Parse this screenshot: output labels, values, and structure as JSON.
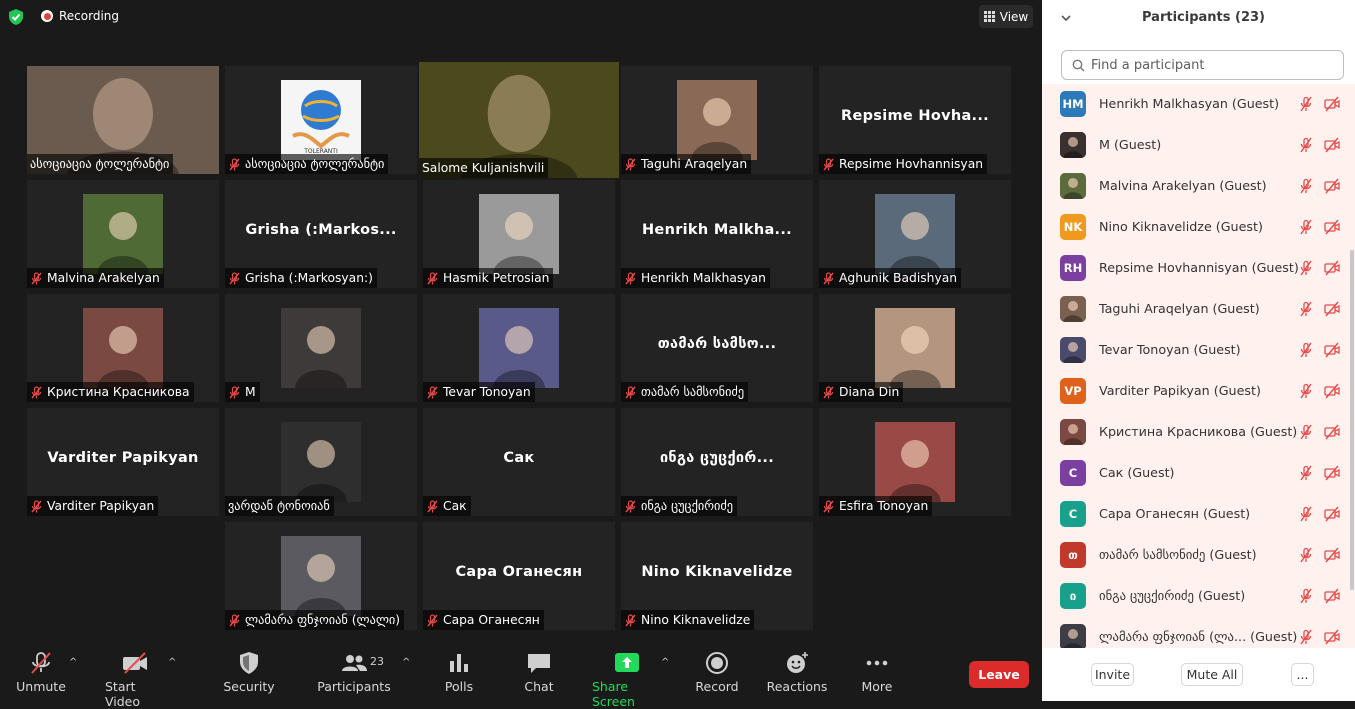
{
  "topbar": {
    "recording_label": "Recording",
    "view_label": "View"
  },
  "tiles": [
    {
      "name": "ასოციაცია ტოლერანტი",
      "kind": "video",
      "muted": false,
      "bg": "#6b5a4e"
    },
    {
      "name": "ასოციაცია ტოლერანტი",
      "kind": "thumb",
      "muted": true,
      "bg": "#f3f3f3",
      "logo_text": "TOLERANTI"
    },
    {
      "name": "Salome Kuljanishvili",
      "kind": "video",
      "muted": false,
      "active": true,
      "bg": "#4c4a1c"
    },
    {
      "name": "Taguhi Araqelyan",
      "kind": "thumb",
      "muted": true,
      "bg": "#8a6a56"
    },
    {
      "name": "Repsime Hovhannisyan",
      "kind": "text",
      "muted": true,
      "big": "Repsime  Hovha..."
    },
    {
      "name": "Malvina Arakelyan",
      "kind": "thumb",
      "muted": true,
      "bg": "#4f6a35"
    },
    {
      "name": "Grisha (:Markosyan:)",
      "kind": "text",
      "muted": true,
      "big": "Grisha  (:Markos..."
    },
    {
      "name": "Hasmik Petrosian",
      "kind": "thumb",
      "muted": true,
      "bg": "#9a9a9a"
    },
    {
      "name": "Henrikh Malkhasyan",
      "kind": "text",
      "muted": true,
      "big": "Henrikh  Malkha..."
    },
    {
      "name": "Aghunik Badishyan",
      "kind": "thumb",
      "muted": true,
      "bg": "#5a6a7a"
    },
    {
      "name": "Кристина Красникова",
      "kind": "thumb",
      "muted": true,
      "bg": "#7a4a42"
    },
    {
      "name": "M",
      "kind": "thumb",
      "muted": true,
      "bg": "#3f3a3a"
    },
    {
      "name": "Tevar Tonoyan",
      "kind": "thumb",
      "muted": true,
      "bg": "#5a5a8a"
    },
    {
      "name": "თამარ სამსონიძე",
      "kind": "text",
      "muted": true,
      "big": "თამარ  სამსო..."
    },
    {
      "name": "Diana Din",
      "kind": "thumb",
      "muted": true,
      "bg": "#b39580"
    },
    {
      "name": "Varditer Papikyan",
      "kind": "text",
      "muted": true,
      "big": "Varditer Papikyan"
    },
    {
      "name": "ვარდან ტონოიან",
      "kind": "thumb",
      "muted": false,
      "bg": "#2e2e2e"
    },
    {
      "name": "Сак",
      "kind": "text",
      "muted": true,
      "big": "Сак"
    },
    {
      "name": "ინგა ცუცქირიძე",
      "kind": "text",
      "muted": true,
      "big": "ინგა  ცუცქირ..."
    },
    {
      "name": "Esfira Tonoyan",
      "kind": "thumb",
      "muted": true,
      "bg": "#9a4a46"
    },
    {
      "name": "ლამარა ფნჯოიან (ლალი)",
      "kind": "thumb",
      "muted": true,
      "bg": "#5a5a60"
    },
    {
      "name": "Сара Оганесян",
      "kind": "text",
      "muted": true,
      "big": "Сара Оганесян"
    },
    {
      "name": "Nino Kiknavelidze",
      "kind": "text",
      "muted": true,
      "big": "Nino Kiknavelidze"
    }
  ],
  "toolbar": {
    "unmute": "Unmute",
    "start_video": "Start Video",
    "security": "Security",
    "participants": "Participants",
    "participants_count": "23",
    "polls": "Polls",
    "chat": "Chat",
    "share_screen": "Share Screen",
    "record": "Record",
    "reactions": "Reactions",
    "more": "More",
    "leave": "Leave"
  },
  "panel": {
    "title": "Participants (23)",
    "search_placeholder": "Find a participant",
    "invite": "Invite",
    "mute_all": "Mute All",
    "more": "...",
    "participants": [
      {
        "name": "Henrikh Malkhasyan (Guest)",
        "initials": "HM",
        "color": "#2d7ab8"
      },
      {
        "name": "M (Guest)",
        "initials": "",
        "color": "#3a3030"
      },
      {
        "name": "Malvina Arakelyan (Guest)",
        "initials": "",
        "color": "#5b6b3c"
      },
      {
        "name": "Nino Kiknavelidze (Guest)",
        "initials": "NK",
        "color": "#ef9a1e"
      },
      {
        "name": "Repsime Hovhannisyan (Guest)",
        "initials": "RH",
        "color": "#7b3fa0"
      },
      {
        "name": "Taguhi Araqelyan (Guest)",
        "initials": "",
        "color": "#7a6050"
      },
      {
        "name": "Tevar Tonoyan (Guest)",
        "initials": "",
        "color": "#4a4a6a"
      },
      {
        "name": "Varditer Papikyan (Guest)",
        "initials": "VP",
        "color": "#e0621a"
      },
      {
        "name": "Кристина Красникова (Guest)",
        "initials": "",
        "color": "#7a4a42"
      },
      {
        "name": "Сак (Guest)",
        "initials": "C",
        "color": "#7b3fa0"
      },
      {
        "name": "Сара Оганесян (Guest)",
        "initials": "C",
        "color": "#17a08a"
      },
      {
        "name": "თამარ სამსონიძე (Guest)",
        "initials": "თ",
        "color": "#c0392b"
      },
      {
        "name": "ინგა ცუცქირიძე (Guest)",
        "initials": "ი",
        "color": "#17a08a"
      },
      {
        "name": "ლამარა ფნჯოიან (ლა... (Guest)",
        "initials": "",
        "color": "#3d3d46"
      }
    ]
  },
  "colors": {
    "accent_active": "#d4e157",
    "muted_red": "#e64b4b",
    "share_green": "#23d959",
    "leave_red": "#dc2b2b"
  }
}
